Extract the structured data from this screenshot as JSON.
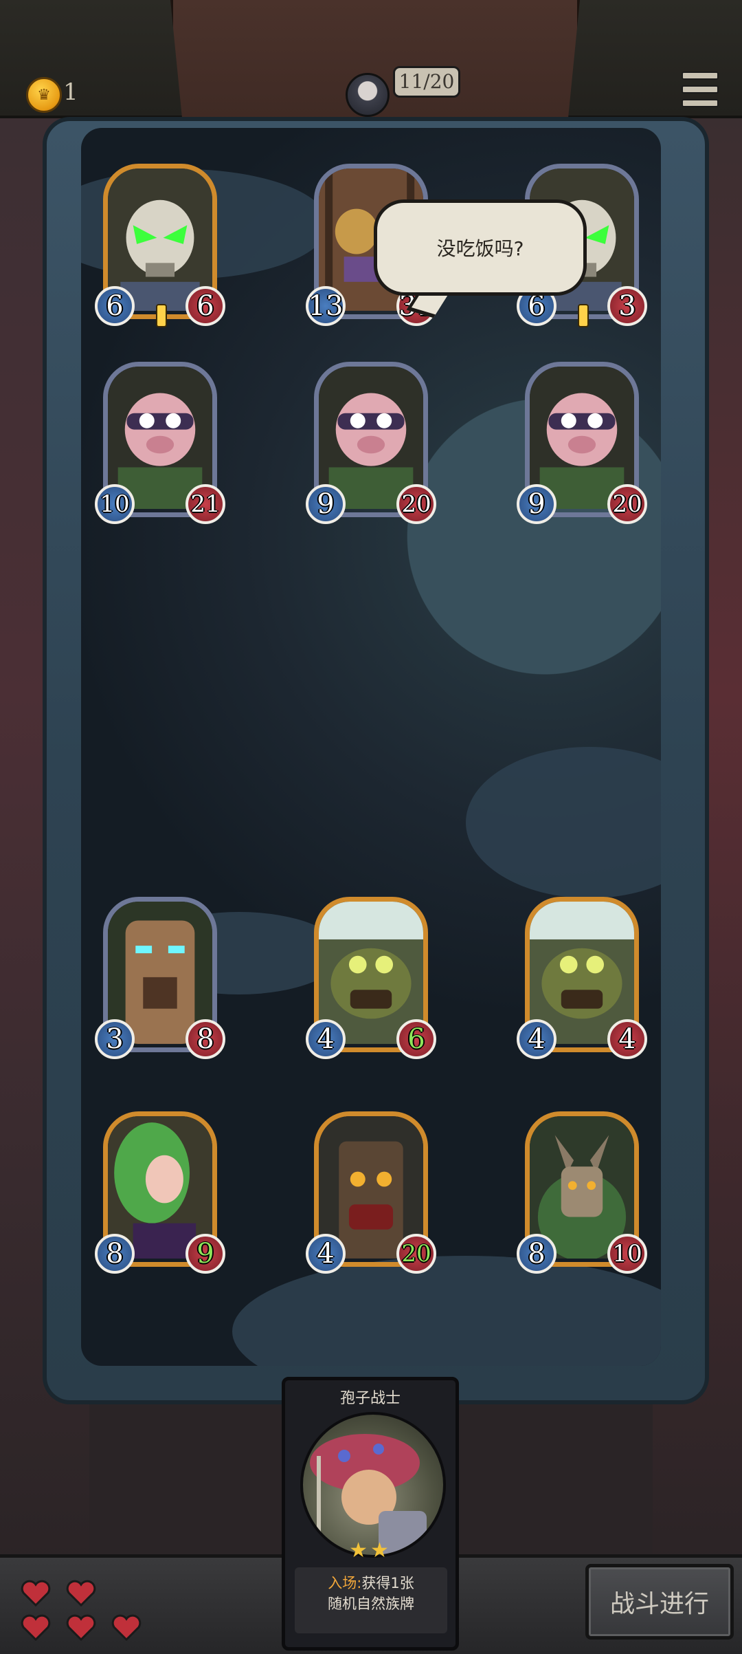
{
  "header": {
    "coins": "1",
    "round": "11/20"
  },
  "bubble": {
    "text": "没吃饭吗?"
  },
  "enemy_units": [
    {
      "attack": "6",
      "health": "6",
      "frame": "gold",
      "kind": "skull"
    },
    {
      "attack": "13",
      "health": "31",
      "frame": "silver",
      "kind": "orc"
    },
    {
      "attack": "6",
      "health": "3",
      "frame": "silver",
      "kind": "skull"
    },
    {
      "attack": "10",
      "health": "21",
      "frame": "silver",
      "kind": "pig"
    },
    {
      "attack": "9",
      "health": "20",
      "frame": "silver",
      "kind": "pig"
    },
    {
      "attack": "9",
      "health": "20",
      "frame": "silver",
      "kind": "pig"
    }
  ],
  "player_units": [
    {
      "attack": "3",
      "health": "8",
      "frame": "silver",
      "kind": "tree"
    },
    {
      "attack": "4",
      "health": "6",
      "frame": "gold",
      "kind": "frog",
      "health_color": "green"
    },
    {
      "attack": "4",
      "health": "4",
      "frame": "gold",
      "kind": "frog"
    },
    {
      "attack": "8",
      "health": "9",
      "frame": "gold",
      "kind": "dryad",
      "health_color": "green"
    },
    {
      "attack": "4",
      "health": "20",
      "frame": "gold",
      "kind": "totem",
      "health_color": "green"
    },
    {
      "attack": "8",
      "health": "10",
      "frame": "gold",
      "kind": "horned"
    }
  ],
  "hand_card": {
    "name": "孢子战士",
    "stars": "★★",
    "desc_keyword": "入场:",
    "desc_line1": "获得1张",
    "desc_line2": "随机自然族牌"
  },
  "lives": {
    "hearts": 5,
    "icon": "heart-icon",
    "color": "#c0303a"
  },
  "battle_button": {
    "label": "战斗进行"
  },
  "colors": {
    "attack": "#3a6aa8",
    "health": "#b3313c",
    "gold_frame": "#d08b2c",
    "silver_frame": "#6e7898"
  }
}
